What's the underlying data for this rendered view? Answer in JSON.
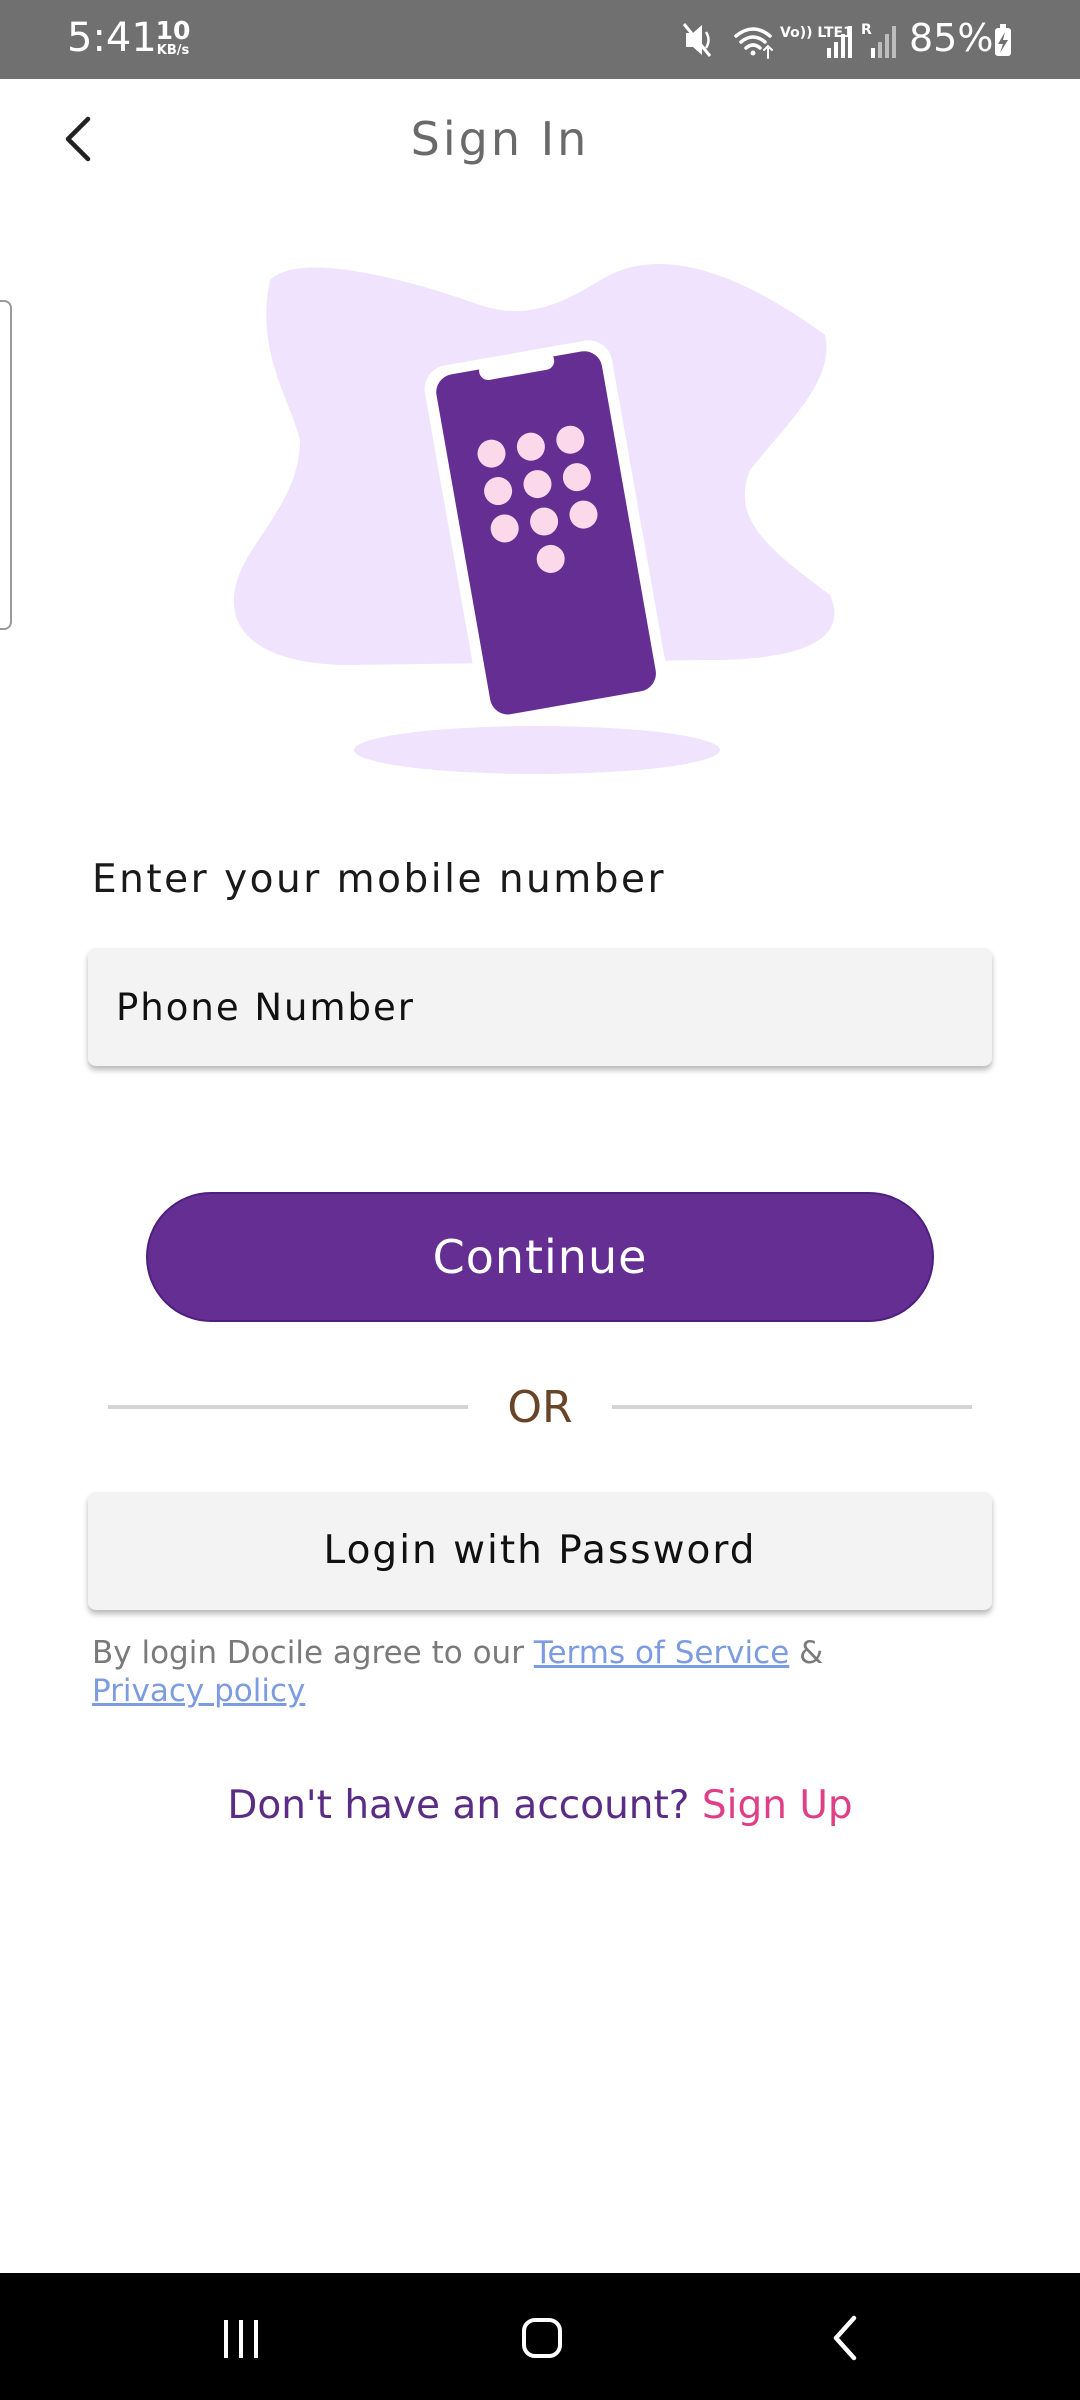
{
  "status_bar": {
    "time": "5:41",
    "net_speed_value": "10",
    "net_speed_unit": "KB/s",
    "battery_percent": "85%",
    "icons": [
      "mute-icon",
      "wifi-icon",
      "volte-icon",
      "signal-icon",
      "roaming-signal-icon",
      "battery-charging-icon"
    ],
    "volte_label": "Vo)) LTE1",
    "roaming_label": "R"
  },
  "header": {
    "title": "Sign In",
    "back_icon": "chevron-left-icon"
  },
  "hero": {
    "illustration": "phone-keypad-illustration"
  },
  "form": {
    "label": "Enter your mobile number",
    "phone_placeholder": "Phone Number",
    "phone_value": "",
    "continue_label": "Continue",
    "or_label": "OR",
    "password_login_label": "Login with Password"
  },
  "terms": {
    "prefix": "By login Docile agree to our",
    "terms_link": "Terms of Service",
    "joiner": "&",
    "privacy_link": "Privacy policy"
  },
  "signup": {
    "prompt": "Don't have an account?",
    "link": "Sign Up"
  },
  "nav_bar": {
    "buttons": [
      "recents-icon",
      "home-icon",
      "back-icon"
    ]
  },
  "colors": {
    "accent": "#642e92",
    "accent_pink": "#df3f86",
    "link_blue": "#7c9be0",
    "hero_blob": "#efe3fd",
    "dot_pink": "#fbd9ea",
    "or_text": "#6a4426"
  }
}
